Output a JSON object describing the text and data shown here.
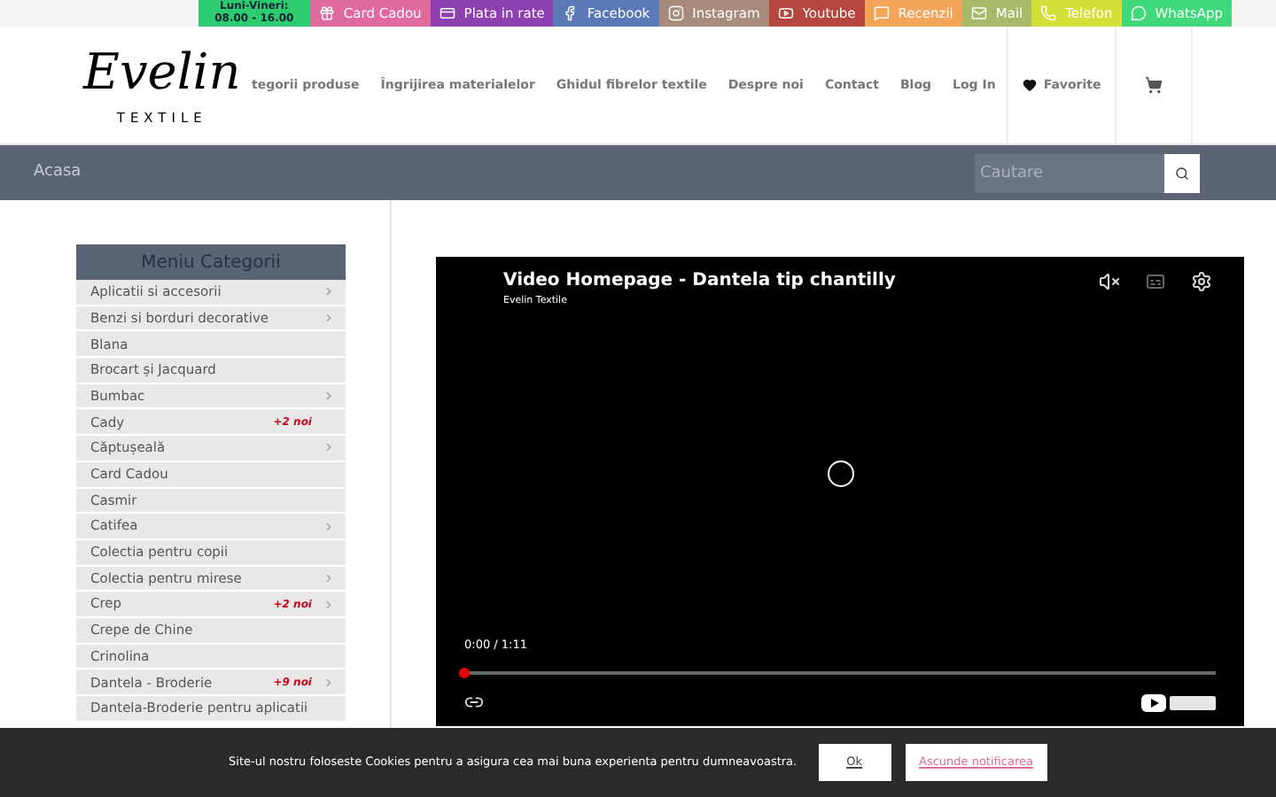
{
  "top_bar": {
    "hours": [
      "Luni-Vineri:",
      "08.00 - 16.00"
    ],
    "links": [
      {
        "label": "Card Cadou",
        "color": "#e06a9b"
      },
      {
        "label": "Plata in rate",
        "color": "#8e3fb0"
      },
      {
        "label": "Facebook",
        "color": "#5b79b7"
      },
      {
        "label": "Instagram",
        "color": "#a88b7c"
      },
      {
        "label": "Youtube",
        "color": "#b5453f"
      },
      {
        "label": "Recenzii",
        "color": "#f5a55a"
      },
      {
        "label": "Mail",
        "color": "#a8b96a"
      },
      {
        "label": "Telefon",
        "color": "#d4e03a"
      },
      {
        "label": "WhatsApp",
        "color": "#3fd87a"
      }
    ]
  },
  "logo": {
    "name": "Evelin",
    "tagline": "TEXTILE"
  },
  "nav": [
    {
      "label": "tegorii produse",
      "kind": "link"
    },
    {
      "label": "Îngrijirea materialelor",
      "kind": "link"
    },
    {
      "label": "Ghidul fibrelor textile",
      "kind": "link"
    },
    {
      "label": "Despre noi",
      "kind": "link"
    },
    {
      "label": "Contact",
      "kind": "link"
    },
    {
      "label": "Blog",
      "kind": "link"
    },
    {
      "label": "Log In",
      "kind": "link"
    },
    {
      "label": "Favorite",
      "kind": "favorites"
    }
  ],
  "breadcrumb": "Acasa",
  "search": {
    "placeholder": "Cautare"
  },
  "sidebar": {
    "title": "Meniu Categorii",
    "items": [
      {
        "label": "Aplicatii si accesorii",
        "submenu": true
      },
      {
        "label": "Benzi si borduri decorative",
        "submenu": true
      },
      {
        "label": "Blana",
        "submenu": false
      },
      {
        "label": "Brocart și Jacquard",
        "submenu": false
      },
      {
        "label": "Bumbac",
        "submenu": true
      },
      {
        "label": "Cady",
        "submenu": false,
        "badge": "+2 noi"
      },
      {
        "label": "Căptușeală",
        "submenu": true
      },
      {
        "label": "Card Cadou",
        "submenu": false
      },
      {
        "label": "Casmir",
        "submenu": false
      },
      {
        "label": "Catifea",
        "submenu": true
      },
      {
        "label": "Colectia pentru copii",
        "submenu": false
      },
      {
        "label": "Colectia pentru mirese",
        "submenu": true
      },
      {
        "label": "Crep",
        "submenu": true,
        "badge": "+2 noi"
      },
      {
        "label": "Crepe de Chine",
        "submenu": false
      },
      {
        "label": "Crinolina",
        "submenu": false
      },
      {
        "label": "Dantela - Broderie",
        "submenu": true,
        "badge": "+9 noi"
      },
      {
        "label": "Dantela-Broderie pentru aplicatii",
        "submenu": false
      }
    ]
  },
  "video": {
    "title": "Video Homepage - Dantela tip chantilly",
    "channel": "Evelin Textile",
    "time": "0:00 / 1:11",
    "level": 0,
    "muted": true
  },
  "cookie": {
    "text": "Site-ul nostru foloseste Cookies pentru a asigura cea mai buna experienta pentru dumneavoastra.",
    "buttons": [
      "Ok",
      "Ascunde notificarea"
    ]
  }
}
